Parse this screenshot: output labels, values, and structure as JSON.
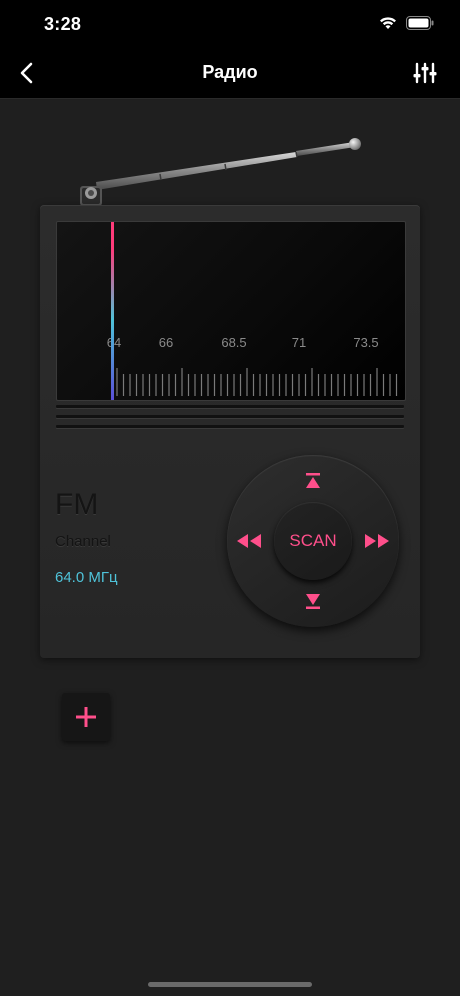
{
  "status": {
    "time": "3:28"
  },
  "nav": {
    "title": "Радио"
  },
  "dial": {
    "labels": [
      "64",
      "66",
      "68.5",
      "71",
      "73.5"
    ]
  },
  "radio": {
    "band": "FM",
    "channel_label": "Channel",
    "frequency": "64.0 МГц"
  },
  "controls": {
    "scan_label": "SCAN"
  },
  "colors": {
    "accent": "#ff4f8b",
    "frequency": "#4fc3d9"
  }
}
